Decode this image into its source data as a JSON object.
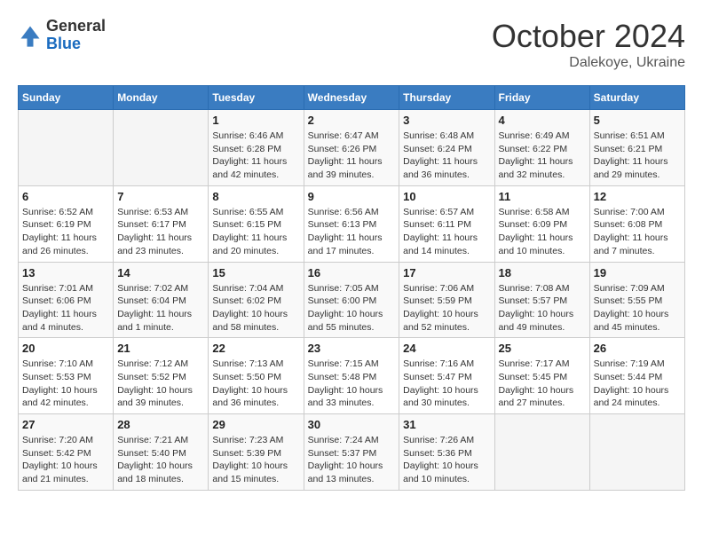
{
  "header": {
    "logo_general": "General",
    "logo_blue": "Blue",
    "month_title": "October 2024",
    "location": "Dalekoye, Ukraine"
  },
  "days_of_week": [
    "Sunday",
    "Monday",
    "Tuesday",
    "Wednesday",
    "Thursday",
    "Friday",
    "Saturday"
  ],
  "weeks": [
    [
      {
        "day": "",
        "sunrise": "",
        "sunset": "",
        "daylight": ""
      },
      {
        "day": "",
        "sunrise": "",
        "sunset": "",
        "daylight": ""
      },
      {
        "day": "1",
        "sunrise": "Sunrise: 6:46 AM",
        "sunset": "Sunset: 6:28 PM",
        "daylight": "Daylight: 11 hours and 42 minutes."
      },
      {
        "day": "2",
        "sunrise": "Sunrise: 6:47 AM",
        "sunset": "Sunset: 6:26 PM",
        "daylight": "Daylight: 11 hours and 39 minutes."
      },
      {
        "day": "3",
        "sunrise": "Sunrise: 6:48 AM",
        "sunset": "Sunset: 6:24 PM",
        "daylight": "Daylight: 11 hours and 36 minutes."
      },
      {
        "day": "4",
        "sunrise": "Sunrise: 6:49 AM",
        "sunset": "Sunset: 6:22 PM",
        "daylight": "Daylight: 11 hours and 32 minutes."
      },
      {
        "day": "5",
        "sunrise": "Sunrise: 6:51 AM",
        "sunset": "Sunset: 6:21 PM",
        "daylight": "Daylight: 11 hours and 29 minutes."
      }
    ],
    [
      {
        "day": "6",
        "sunrise": "Sunrise: 6:52 AM",
        "sunset": "Sunset: 6:19 PM",
        "daylight": "Daylight: 11 hours and 26 minutes."
      },
      {
        "day": "7",
        "sunrise": "Sunrise: 6:53 AM",
        "sunset": "Sunset: 6:17 PM",
        "daylight": "Daylight: 11 hours and 23 minutes."
      },
      {
        "day": "8",
        "sunrise": "Sunrise: 6:55 AM",
        "sunset": "Sunset: 6:15 PM",
        "daylight": "Daylight: 11 hours and 20 minutes."
      },
      {
        "day": "9",
        "sunrise": "Sunrise: 6:56 AM",
        "sunset": "Sunset: 6:13 PM",
        "daylight": "Daylight: 11 hours and 17 minutes."
      },
      {
        "day": "10",
        "sunrise": "Sunrise: 6:57 AM",
        "sunset": "Sunset: 6:11 PM",
        "daylight": "Daylight: 11 hours and 14 minutes."
      },
      {
        "day": "11",
        "sunrise": "Sunrise: 6:58 AM",
        "sunset": "Sunset: 6:09 PM",
        "daylight": "Daylight: 11 hours and 10 minutes."
      },
      {
        "day": "12",
        "sunrise": "Sunrise: 7:00 AM",
        "sunset": "Sunset: 6:08 PM",
        "daylight": "Daylight: 11 hours and 7 minutes."
      }
    ],
    [
      {
        "day": "13",
        "sunrise": "Sunrise: 7:01 AM",
        "sunset": "Sunset: 6:06 PM",
        "daylight": "Daylight: 11 hours and 4 minutes."
      },
      {
        "day": "14",
        "sunrise": "Sunrise: 7:02 AM",
        "sunset": "Sunset: 6:04 PM",
        "daylight": "Daylight: 11 hours and 1 minute."
      },
      {
        "day": "15",
        "sunrise": "Sunrise: 7:04 AM",
        "sunset": "Sunset: 6:02 PM",
        "daylight": "Daylight: 10 hours and 58 minutes."
      },
      {
        "day": "16",
        "sunrise": "Sunrise: 7:05 AM",
        "sunset": "Sunset: 6:00 PM",
        "daylight": "Daylight: 10 hours and 55 minutes."
      },
      {
        "day": "17",
        "sunrise": "Sunrise: 7:06 AM",
        "sunset": "Sunset: 5:59 PM",
        "daylight": "Daylight: 10 hours and 52 minutes."
      },
      {
        "day": "18",
        "sunrise": "Sunrise: 7:08 AM",
        "sunset": "Sunset: 5:57 PM",
        "daylight": "Daylight: 10 hours and 49 minutes."
      },
      {
        "day": "19",
        "sunrise": "Sunrise: 7:09 AM",
        "sunset": "Sunset: 5:55 PM",
        "daylight": "Daylight: 10 hours and 45 minutes."
      }
    ],
    [
      {
        "day": "20",
        "sunrise": "Sunrise: 7:10 AM",
        "sunset": "Sunset: 5:53 PM",
        "daylight": "Daylight: 10 hours and 42 minutes."
      },
      {
        "day": "21",
        "sunrise": "Sunrise: 7:12 AM",
        "sunset": "Sunset: 5:52 PM",
        "daylight": "Daylight: 10 hours and 39 minutes."
      },
      {
        "day": "22",
        "sunrise": "Sunrise: 7:13 AM",
        "sunset": "Sunset: 5:50 PM",
        "daylight": "Daylight: 10 hours and 36 minutes."
      },
      {
        "day": "23",
        "sunrise": "Sunrise: 7:15 AM",
        "sunset": "Sunset: 5:48 PM",
        "daylight": "Daylight: 10 hours and 33 minutes."
      },
      {
        "day": "24",
        "sunrise": "Sunrise: 7:16 AM",
        "sunset": "Sunset: 5:47 PM",
        "daylight": "Daylight: 10 hours and 30 minutes."
      },
      {
        "day": "25",
        "sunrise": "Sunrise: 7:17 AM",
        "sunset": "Sunset: 5:45 PM",
        "daylight": "Daylight: 10 hours and 27 minutes."
      },
      {
        "day": "26",
        "sunrise": "Sunrise: 7:19 AM",
        "sunset": "Sunset: 5:44 PM",
        "daylight": "Daylight: 10 hours and 24 minutes."
      }
    ],
    [
      {
        "day": "27",
        "sunrise": "Sunrise: 7:20 AM",
        "sunset": "Sunset: 5:42 PM",
        "daylight": "Daylight: 10 hours and 21 minutes."
      },
      {
        "day": "28",
        "sunrise": "Sunrise: 7:21 AM",
        "sunset": "Sunset: 5:40 PM",
        "daylight": "Daylight: 10 hours and 18 minutes."
      },
      {
        "day": "29",
        "sunrise": "Sunrise: 7:23 AM",
        "sunset": "Sunset: 5:39 PM",
        "daylight": "Daylight: 10 hours and 15 minutes."
      },
      {
        "day": "30",
        "sunrise": "Sunrise: 7:24 AM",
        "sunset": "Sunset: 5:37 PM",
        "daylight": "Daylight: 10 hours and 13 minutes."
      },
      {
        "day": "31",
        "sunrise": "Sunrise: 7:26 AM",
        "sunset": "Sunset: 5:36 PM",
        "daylight": "Daylight: 10 hours and 10 minutes."
      },
      {
        "day": "",
        "sunrise": "",
        "sunset": "",
        "daylight": ""
      },
      {
        "day": "",
        "sunrise": "",
        "sunset": "",
        "daylight": ""
      }
    ]
  ]
}
